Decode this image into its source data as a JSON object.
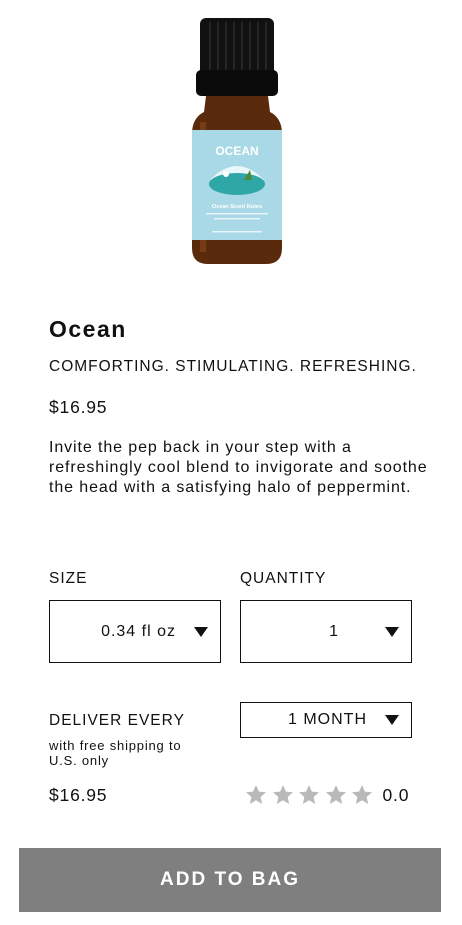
{
  "product": {
    "image_label": "OCEAN",
    "image_sublabel": "Ocean Scent Notes",
    "name": "Ocean",
    "tagline": "COMFORTING. STIMULATING. REFRESHING.",
    "price": "$16.95",
    "description": "Invite the pep back in your step with a refreshingly cool blend to invigorate and soothe the head with a satisfying halo of peppermint."
  },
  "options": {
    "size_label": "SIZE",
    "size_value": "0.34 fl oz",
    "quantity_label": "QUANTITY",
    "quantity_value": "1",
    "deliver_label": "DELIVER EVERY",
    "deliver_value": "1 MONTH",
    "shipping_note": "with free shipping to U.S. only"
  },
  "summary": {
    "price": "$16.95",
    "rating_value": "0.0",
    "stars_filled": 0,
    "stars_total": 5,
    "star_color": "#b9b9b9"
  },
  "actions": {
    "add_to_bag": "ADD TO BAG",
    "button_color": "#7f7f7f"
  }
}
